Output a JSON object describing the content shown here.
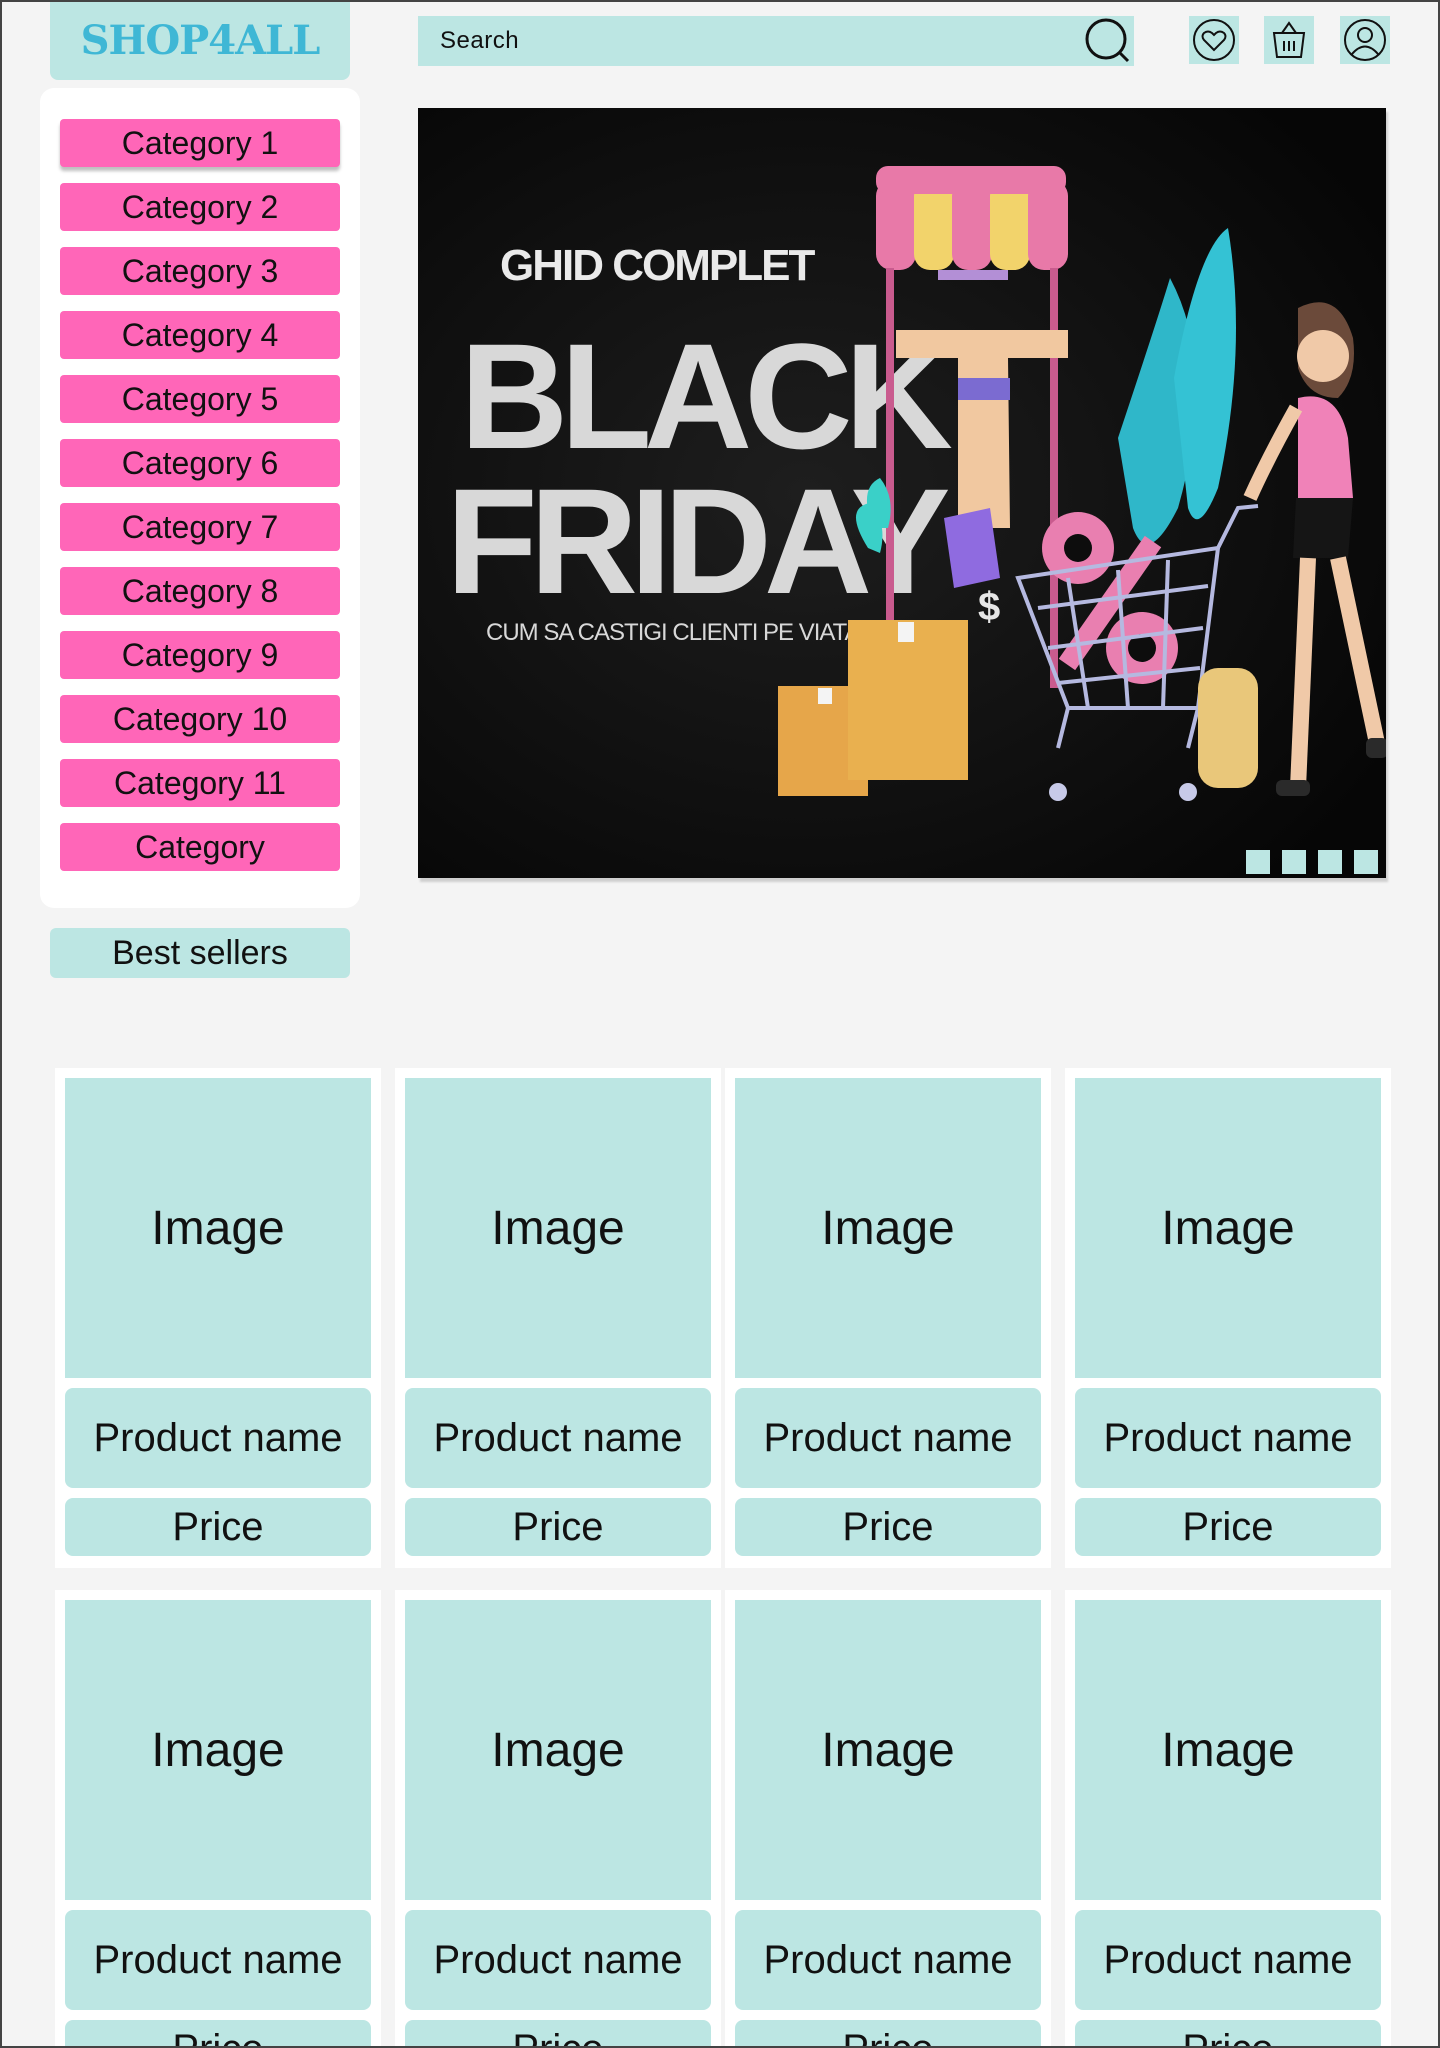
{
  "header": {
    "logo": "SHOP4ALL",
    "search_placeholder": "Search"
  },
  "icons": {
    "search": "search-icon",
    "wishlist": "heart-icon",
    "cart": "basket-icon",
    "account": "user-icon"
  },
  "sidebar": {
    "categories": [
      "Category 1",
      "Category 2",
      "Category 3",
      "Category 4",
      "Category 5",
      "Category 6",
      "Category 7",
      "Category 8",
      "Category 9",
      "Category 10",
      "Category 11",
      "Category"
    ]
  },
  "banner": {
    "kicker": "GHID COMPLET",
    "headline_1": "BLACK",
    "headline_2": "FRIDAY",
    "tagline": "CUM SA CASTIGI CLIENTI PE VIATA",
    "slide_count": 4
  },
  "best_sellers_label": "Best sellers",
  "products": [
    {
      "image": "Image",
      "name": "Product name",
      "price": "Price"
    },
    {
      "image": "Image",
      "name": "Product name",
      "price": "Price"
    },
    {
      "image": "Image",
      "name": "Product name",
      "price": "Price"
    },
    {
      "image": "Image",
      "name": "Product name",
      "price": "Price"
    },
    {
      "image": "Image",
      "name": "Product name",
      "price": "Price"
    },
    {
      "image": "Image",
      "name": "Product name",
      "price": "Price"
    },
    {
      "image": "Image",
      "name": "Product name",
      "price": "Price"
    },
    {
      "image": "Image",
      "name": "Product name",
      "price": "Price"
    }
  ],
  "colors": {
    "accent": "#bce6e3",
    "category": "#ff66b8",
    "logo": "#3fb7d5",
    "background": "#f4f4f4"
  }
}
